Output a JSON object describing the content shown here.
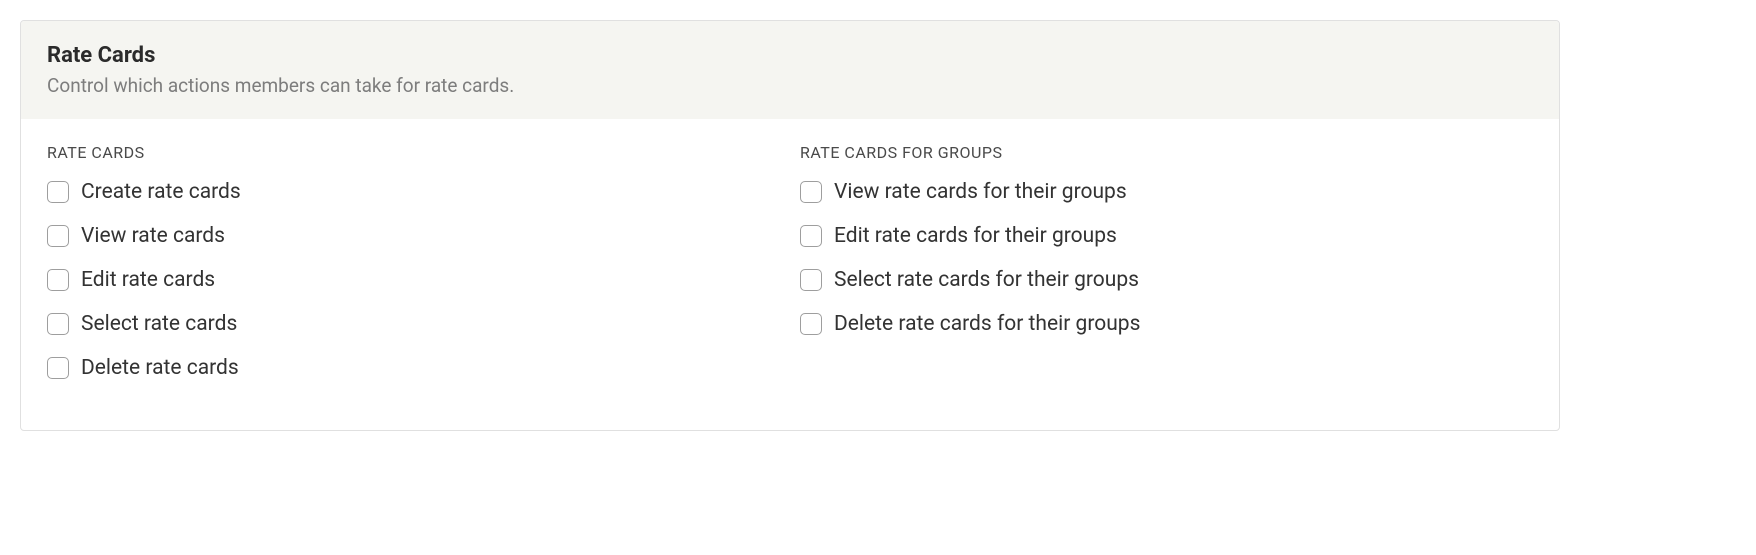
{
  "header": {
    "title": "Rate Cards",
    "subtitle": "Control which actions members can take for rate cards."
  },
  "columns": {
    "left": {
      "heading": "RATE CARDS",
      "options": [
        {
          "label": "Create rate cards"
        },
        {
          "label": "View rate cards"
        },
        {
          "label": "Edit rate cards"
        },
        {
          "label": "Select rate cards"
        },
        {
          "label": "Delete rate cards"
        }
      ]
    },
    "right": {
      "heading": "RATE CARDS FOR GROUPS",
      "options": [
        {
          "label": "View rate cards for their groups"
        },
        {
          "label": "Edit rate cards for their groups"
        },
        {
          "label": "Select rate cards for their groups"
        },
        {
          "label": "Delete rate cards for their groups"
        }
      ]
    }
  }
}
